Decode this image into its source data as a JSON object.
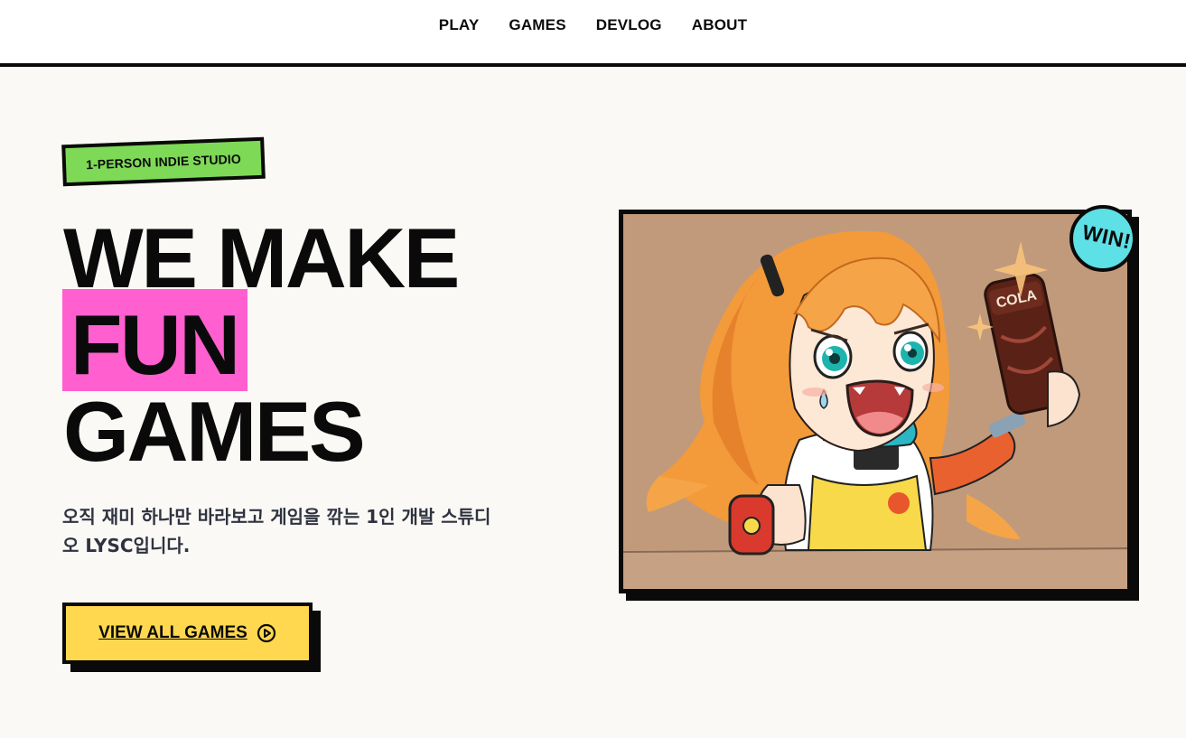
{
  "nav": {
    "items": [
      {
        "label": "PLAY"
      },
      {
        "label": "GAMES"
      },
      {
        "label": "DEVLOG"
      },
      {
        "label": "ABOUT"
      }
    ]
  },
  "hero": {
    "badge": "1-PERSON INDIE STUDIO",
    "headline": {
      "line1": "WE MAKE",
      "line2": "FUN",
      "line3": "GAMES"
    },
    "description_line1": "오직 재미 하나만 바라보고 게임을 깎는 1인 개발 스튜디",
    "description_line2": "오 LYSC입니다.",
    "cta_label": "VIEW ALL GAMES",
    "cta_icon": "play-circle-icon",
    "art": {
      "sticker": "WIN!",
      "can_label": "COLA",
      "illustration": "anime-girl-holding-cola-illustration"
    }
  },
  "colors": {
    "background": "#fbf9f5",
    "badge_green": "#7ed957",
    "highlight_pink": "#ff5fcf",
    "cta_yellow": "#ffd84f",
    "sticker_cyan": "#5de0e6",
    "ink": "#0a0a0a"
  }
}
